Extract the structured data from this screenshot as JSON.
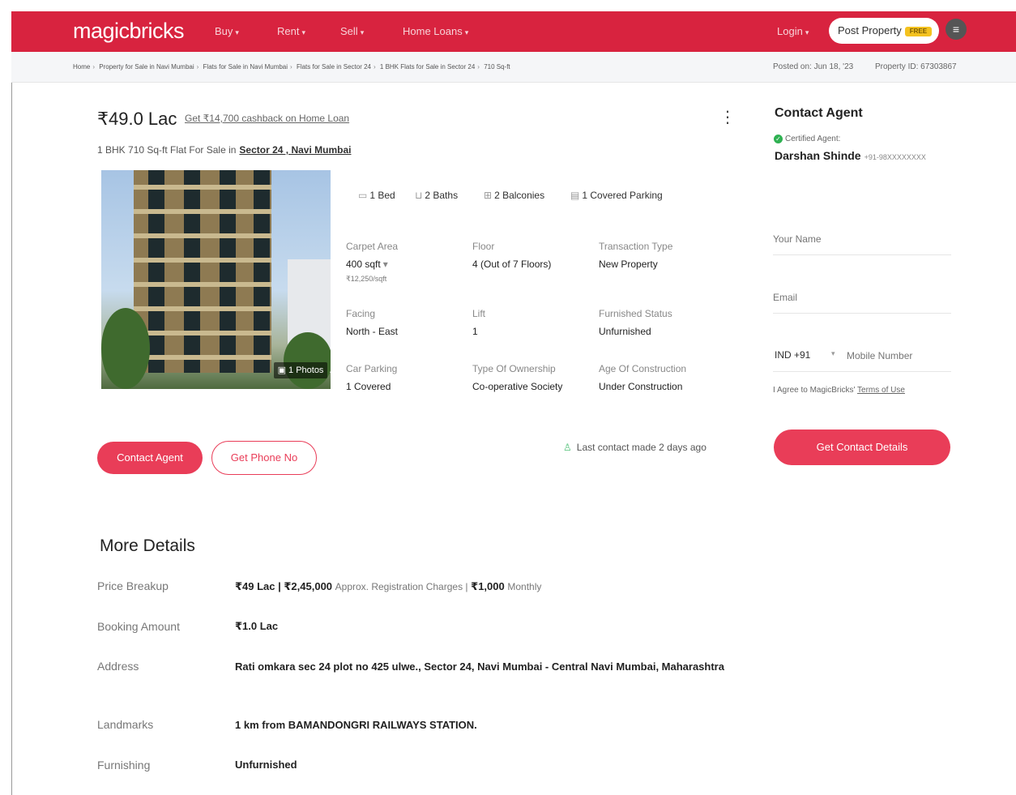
{
  "header": {
    "logo": "magicbricks",
    "nav": [
      {
        "label": "Buy"
      },
      {
        "label": "Rent"
      },
      {
        "label": "Sell"
      },
      {
        "label": "Home Loans"
      }
    ],
    "login": "Login",
    "post_property": "Post Property",
    "free_badge": "FREE"
  },
  "breadcrumb": {
    "items": [
      "Home",
      "Property for Sale in Navi Mumbai",
      "Flats for Sale in Navi Mumbai",
      "Flats for Sale in Sector 24",
      "1 BHK Flats for Sale in Sector 24",
      "710 Sq-ft"
    ],
    "posted_on": "Posted on: Jun 18, '23",
    "property_id": "Property ID: 67303867"
  },
  "listing": {
    "price": "₹49.0 Lac",
    "cashback": "Get ₹14,700 cashback on Home Loan",
    "subtitle": "1 BHK 710 Sq-ft Flat For Sale in",
    "location": "Sector 24 , Navi Mumbai",
    "photo_count": "1 Photos",
    "amenities": [
      "1 Bed",
      "2 Baths",
      "2 Balconies",
      "1 Covered Parking"
    ],
    "details": [
      {
        "label": "Carpet Area",
        "value": "400 sqft",
        "sub": "₹12,250/sqft"
      },
      {
        "label": "Floor",
        "value": "4 (Out of 7 Floors)"
      },
      {
        "label": "Transaction Type",
        "value": "New Property"
      },
      {
        "label": "Facing",
        "value": "North - East"
      },
      {
        "label": "Lift",
        "value": "1"
      },
      {
        "label": "Furnished Status",
        "value": "Unfurnished"
      },
      {
        "label": "Car Parking",
        "value": "1 Covered"
      },
      {
        "label": "Type Of Ownership",
        "value": "Co-operative Society"
      },
      {
        "label": "Age Of Construction",
        "value": "Under Construction"
      }
    ],
    "contact_agent_btn": "Contact Agent",
    "get_phone_btn": "Get Phone No",
    "last_contact": "Last contact made 2 days ago"
  },
  "contact": {
    "title": "Contact Agent",
    "certified": "Certified Agent:",
    "agent_name": "Darshan Shinde",
    "agent_phone": "+91-98XXXXXXXX",
    "name_placeholder": "Your Name",
    "email_placeholder": "Email",
    "country_code": "IND +91",
    "mobile_placeholder": "Mobile Number",
    "agree_text": "I Agree to MagicBricks'",
    "terms": "Terms of Use",
    "submit": "Get Contact Details"
  },
  "more_details": {
    "title": "More Details",
    "price_breakup_label": "Price Breakup",
    "price_main": "₹49 Lac | ₹2,45,000",
    "price_reg": "Approx. Registration Charges |",
    "price_monthly_amt": "₹1,000",
    "price_monthly": "Monthly",
    "booking_label": "Booking Amount",
    "booking_value": "₹1.0 Lac",
    "address_label": "Address",
    "address_value": "Rati omkara sec 24 plot no 425 ulwe., Sector 24, Navi Mumbai - Central Navi Mumbai, Maharashtra",
    "landmarks_label": "Landmarks",
    "landmarks_value": "1 km from BAMANDONGRI RAILWAYS STATION.",
    "furnishing_label": "Furnishing",
    "furnishing_value": "Unfurnished"
  }
}
